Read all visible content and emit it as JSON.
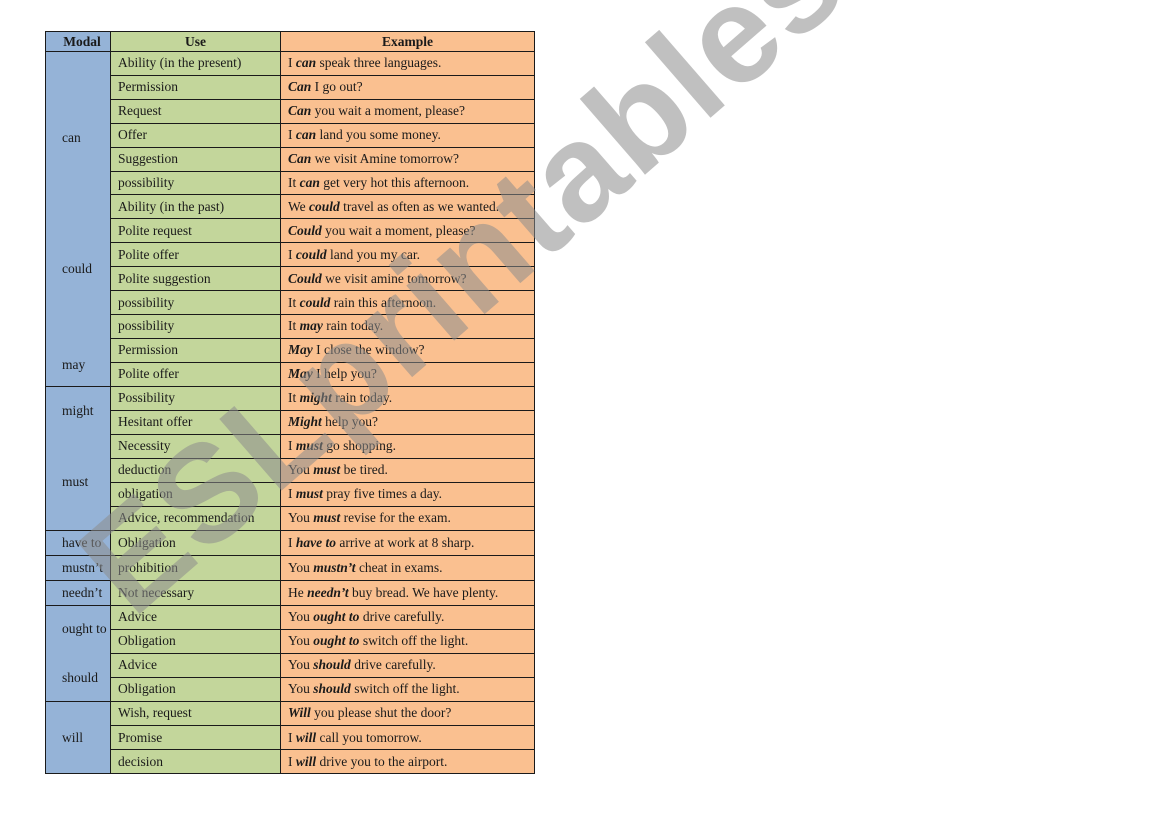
{
  "headers": {
    "modal": "Modal",
    "use": "Use",
    "example": "Example"
  },
  "colors": {
    "modal_bg": "#95b3d7",
    "use_bg": "#c3d69b",
    "example_bg": "#fac090",
    "watermark": "#8c8c8c"
  },
  "rows": [
    {
      "modal": "can",
      "use": "Ability (in the present)",
      "pre": "I ",
      "modal_word": "can",
      "post": " speak three languages."
    },
    {
      "modal": "",
      "use": "Permission",
      "pre": "",
      "modal_word": "Can",
      "post": " I go out?"
    },
    {
      "modal": "",
      "use": "Request",
      "pre": "",
      "modal_word": "Can",
      "post": " you wait a moment, please?"
    },
    {
      "modal": "",
      "use": "Offer",
      "pre": "I ",
      "modal_word": "can",
      "post": " land you some money."
    },
    {
      "modal": "",
      "use": "Suggestion",
      "pre": "",
      "modal_word": "Can",
      "post": " we visit Amine tomorrow?"
    },
    {
      "modal": "",
      "use": "possibility",
      "pre": "It ",
      "modal_word": "can",
      "post": " get very hot this afternoon."
    },
    {
      "modal": "could",
      "use": "Ability (in the past)",
      "pre": "We ",
      "modal_word": "could",
      "post": " travel as often as we wanted."
    },
    {
      "modal": "",
      "use": "Polite request",
      "pre": "",
      "modal_word": "Could",
      "post": " you wait a moment, please?"
    },
    {
      "modal": "",
      "use": "Polite offer",
      "pre": "I ",
      "modal_word": "could",
      "post": " land you my car."
    },
    {
      "modal": "",
      "use": "Polite suggestion",
      "pre": "",
      "modal_word": "Could",
      "post": " we visit amine tomorrow?"
    },
    {
      "modal": "",
      "use": "possibility",
      "pre": "It ",
      "modal_word": "could",
      "post": " rain this afternoon."
    },
    {
      "modal": "may",
      "use": "possibility",
      "pre": "It ",
      "modal_word": "may",
      "post": " rain today."
    },
    {
      "modal": "",
      "use": "Permission",
      "pre": "",
      "modal_word": "May",
      "post": " I close the window?"
    },
    {
      "modal": "",
      "use": "Polite offer",
      "pre": "",
      "modal_word": "May",
      "post": " I help you?"
    },
    {
      "modal": "might",
      "use": "Possibility",
      "pre": "It ",
      "modal_word": "might",
      "post": " rain today."
    },
    {
      "modal": "",
      "use": "Hesitant offer",
      "pre": "",
      "modal_word": "Might",
      "post": " help you?"
    },
    {
      "modal": "must",
      "use": "Necessity",
      "pre": "I ",
      "modal_word": "must",
      "post": " go shopping."
    },
    {
      "modal": "",
      "use": "deduction",
      "pre": "You ",
      "modal_word": "must",
      "post": " be tired."
    },
    {
      "modal": "",
      "use": "obligation",
      "pre": "I ",
      "modal_word": "must",
      "post": " pray five times a day."
    },
    {
      "modal": "",
      "use": "Advice, recommendation",
      "pre": "You ",
      "modal_word": "must",
      "post": " revise for the exam."
    },
    {
      "modal": "have to",
      "use": "Obligation",
      "pre": "I ",
      "modal_word": "have to",
      "post": " arrive at work at 8 sharp."
    },
    {
      "modal": "mustn’t",
      "use": "prohibition",
      "pre": "You ",
      "modal_word": "mustn’t",
      "post": " cheat in exams."
    },
    {
      "modal": "needn’t",
      "use": "Not necessary",
      "pre": "He ",
      "modal_word": "needn’t",
      "post": " buy bread. We have plenty."
    },
    {
      "modal": "ought to",
      "use": "Advice",
      "pre": "You ",
      "modal_word": "ought to",
      "post": " drive carefully."
    },
    {
      "modal": "",
      "use": "Obligation",
      "pre": "You ",
      "modal_word": "ought to",
      "post": " switch off the light."
    },
    {
      "modal": "should",
      "use": "Advice",
      "pre": "You ",
      "modal_word": "should",
      "post": " drive carefully."
    },
    {
      "modal": "",
      "use": "Obligation",
      "pre": "You ",
      "modal_word": "should",
      "post": " switch off the light."
    },
    {
      "modal": "will",
      "use": "Wish, request",
      "pre": "",
      "modal_word": "Will",
      "post": " you please shut the door?"
    },
    {
      "modal": "",
      "use": "Promise",
      "pre": "I ",
      "modal_word": "will",
      "post": " call you tomorrow."
    },
    {
      "modal": "",
      "use": "decision",
      "pre": "I ",
      "modal_word": "will",
      "post": " drive you to the airport."
    }
  ],
  "modal_groups": [
    {
      "labels": [
        "can",
        "could",
        "may"
      ],
      "label_rows": [
        3,
        8,
        13
      ],
      "start": 0,
      "span": 14
    },
    {
      "labels": [
        "might",
        "must"
      ],
      "label_rows": [
        0,
        3
      ],
      "start": 14,
      "span": 6
    },
    {
      "labels": [
        "have to"
      ],
      "label_rows": [
        0
      ],
      "start": 20,
      "span": 1
    },
    {
      "labels": [
        "mustn’t"
      ],
      "label_rows": [
        0
      ],
      "start": 21,
      "span": 1
    },
    {
      "labels": [
        "needn’t"
      ],
      "label_rows": [
        0
      ],
      "start": 22,
      "span": 1
    },
    {
      "labels": [
        "ought to",
        "should"
      ],
      "label_rows": [
        0,
        2
      ],
      "start": 23,
      "span": 4
    },
    {
      "labels": [
        "will"
      ],
      "label_rows": [
        1
      ],
      "start": 27,
      "span": 3
    }
  ],
  "watermark": {
    "text": "ESLprintables.com"
  }
}
